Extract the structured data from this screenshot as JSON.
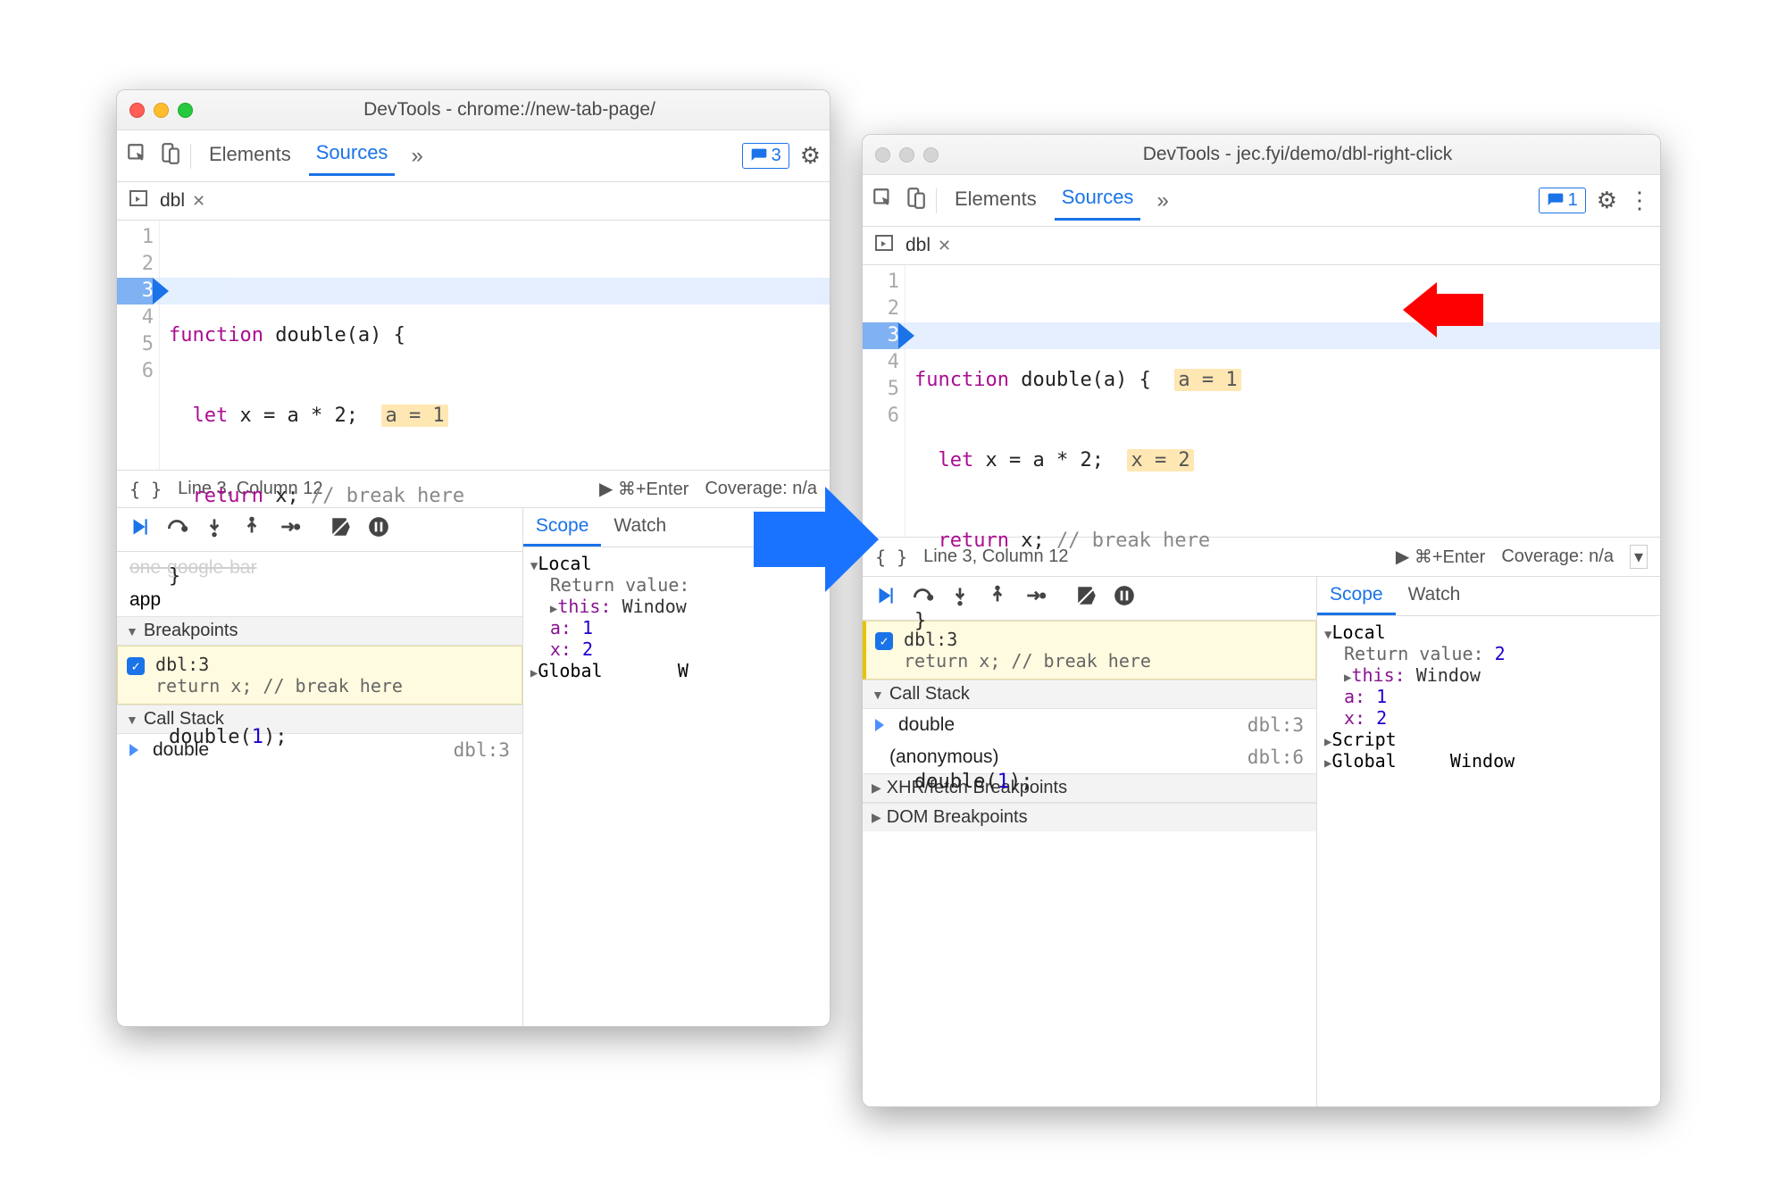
{
  "win1": {
    "title": "DevTools - chrome://new-tab-page/",
    "tabs": {
      "elements": "Elements",
      "sources": "Sources"
    },
    "issues_count": "3",
    "file_tab": "dbl",
    "code": {
      "lines": [
        "1",
        "2",
        "3",
        "4",
        "5",
        "6"
      ],
      "l1_kw": "function",
      "l1_rest": " double(a) {",
      "l2_kw": "let",
      "l2_rest": " x = a * 2;",
      "l2_ann": "a = 1",
      "l3_kw": "return",
      "l3_rest": " x; ",
      "l3_cm": "// break here",
      "l4": "}",
      "l6": "double(",
      "l6_num": "1",
      "l6_end": ");",
      "hl_line": 3
    },
    "status": {
      "braces": "{ }",
      "pos": "Line 3, Column 12",
      "run": "▶ ⌘+Enter",
      "cov": "Coverage: n/a"
    },
    "left": {
      "app_row": "app",
      "breakpoints_hdr": "Breakpoints",
      "bp": {
        "loc": "dbl:3",
        "snippet": "return x; // break here"
      },
      "callstack_hdr": "Call Stack",
      "stack": [
        {
          "name": "double",
          "loc": "dbl:3"
        }
      ]
    },
    "scope": {
      "tabs": {
        "scope": "Scope",
        "watch": "Watch"
      },
      "local": "Local",
      "return_lbl": "Return value:",
      "this_lbl": "this:",
      "this_val": "Window",
      "a_lbl": "a:",
      "a_val": "1",
      "x_lbl": "x:",
      "x_val": "2",
      "global": "Global",
      "global_val": "W"
    }
  },
  "win2": {
    "title": "DevTools - jec.fyi/demo/dbl-right-click",
    "tabs": {
      "elements": "Elements",
      "sources": "Sources"
    },
    "issues_count": "1",
    "file_tab": "dbl",
    "code": {
      "lines": [
        "1",
        "2",
        "3",
        "4",
        "5",
        "6"
      ],
      "l1_kw": "function",
      "l1_rest": " double(a) {",
      "l1_ann": "a = 1",
      "l2_kw": "let",
      "l2_rest": " x = a * 2;",
      "l2_ann": "x = 2",
      "l3_kw": "return",
      "l3_rest": " x; ",
      "l3_cm": "// break here",
      "l4": "}",
      "l6": "double(",
      "l6_num": "1",
      "l6_end": ");",
      "hl_line": 3
    },
    "status": {
      "braces": "{ }",
      "pos": "Line 3, Column 12",
      "run": "▶ ⌘+Enter",
      "cov": "Coverage: n/a"
    },
    "left": {
      "bp": {
        "loc": "dbl:3",
        "snippet": "return x; // break here"
      },
      "callstack_hdr": "Call Stack",
      "stack": [
        {
          "name": "double",
          "loc": "dbl:3"
        },
        {
          "name": "(anonymous)",
          "loc": "dbl:6"
        }
      ],
      "xhr_hdr": "XHR/fetch Breakpoints",
      "dom_hdr": "DOM Breakpoints"
    },
    "scope": {
      "tabs": {
        "scope": "Scope",
        "watch": "Watch"
      },
      "local": "Local",
      "return_lbl": "Return value:",
      "return_val": "2",
      "this_lbl": "this:",
      "this_val": "Window",
      "a_lbl": "a:",
      "a_val": "1",
      "x_lbl": "x:",
      "x_val": "2",
      "script": "Script",
      "global": "Global",
      "global_val": "Window"
    }
  }
}
